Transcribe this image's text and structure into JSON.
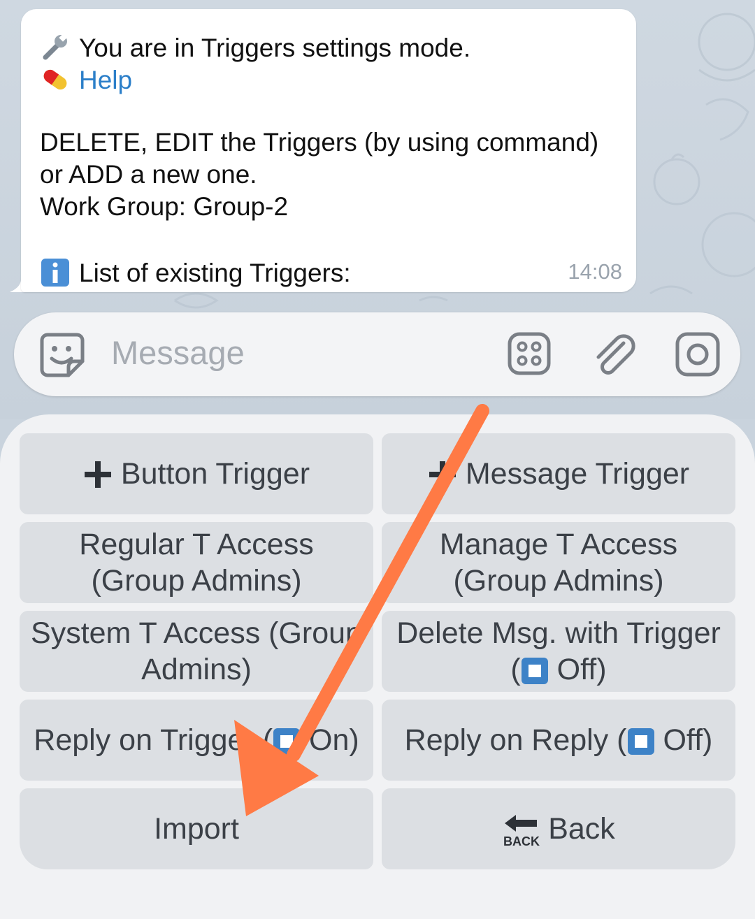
{
  "message": {
    "line1": "You are in Triggers settings mode.",
    "help_link": "Help",
    "line3": "DELETE, EDIT the Triggers (by using command)",
    "line4": "or ADD a new one.",
    "line5": "Work Group: Group-2",
    "line6": "List of existing Triggers:",
    "time": "14:08",
    "icons": [
      "wrench-icon",
      "pill-icon",
      "info-icon"
    ]
  },
  "input": {
    "placeholder": "Message",
    "icons": [
      "sticker-icon",
      "bot-menu-icon",
      "attach-icon",
      "camera-icon"
    ]
  },
  "keyboard": {
    "buttons": [
      {
        "label": "Button Trigger",
        "icon": "plus-icon"
      },
      {
        "label": "Message Trigger",
        "icon": "plus-icon"
      },
      {
        "label1": "Regular T Access",
        "label2": "(Group Admins)"
      },
      {
        "label1": "Manage T Access",
        "label2": "(Group Admins)"
      },
      {
        "label1": "System T Access (Group",
        "label2": "Admins)"
      },
      {
        "label1": "Delete Msg. with Trigger",
        "label2_pre": "(",
        "label2_post": " Off)"
      },
      {
        "label_pre": "Reply on Trigger (",
        "label_post": " On)"
      },
      {
        "label_pre": "Reply on Reply (",
        "label_post": " Off)"
      },
      {
        "label": "Import"
      },
      {
        "label": "Back",
        "icon": "back-arrow-icon",
        "icon_text": "BACK"
      }
    ]
  },
  "annotation": {
    "type": "arrow",
    "color": "#ff7a45"
  }
}
